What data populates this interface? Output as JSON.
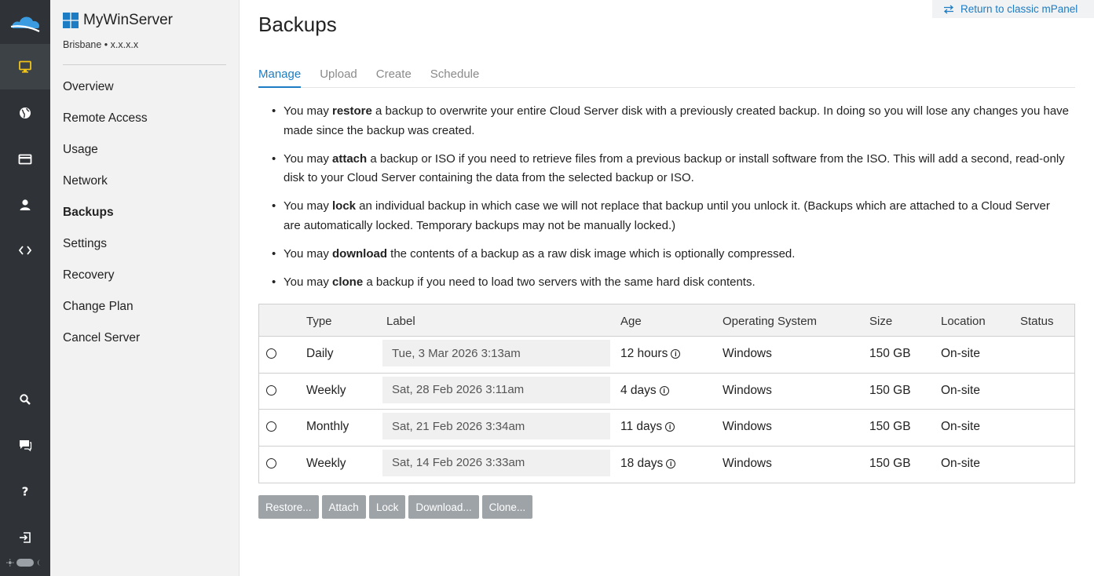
{
  "rail": {
    "items": [
      {
        "icon": "monitor-icon",
        "active": true
      },
      {
        "icon": "globe-icon",
        "active": false
      },
      {
        "icon": "credit-card-icon",
        "active": false
      },
      {
        "icon": "user-icon",
        "active": false
      },
      {
        "icon": "code-icon",
        "active": false
      },
      {
        "icon": "search-icon",
        "active": false
      },
      {
        "icon": "chat-icon",
        "active": false
      },
      {
        "icon": "help-icon",
        "active": false
      },
      {
        "icon": "logout-icon",
        "active": false
      }
    ],
    "accent_color": "#f0c419"
  },
  "server": {
    "name": "MyWinServer",
    "subtitle": "Brisbane • x.x.x.x"
  },
  "nav": {
    "items": [
      {
        "label": "Overview"
      },
      {
        "label": "Remote Access"
      },
      {
        "label": "Usage"
      },
      {
        "label": "Network"
      },
      {
        "label": "Backups",
        "active": true
      },
      {
        "label": "Settings"
      },
      {
        "label": "Recovery"
      },
      {
        "label": "Change Plan"
      },
      {
        "label": "Cancel Server"
      }
    ]
  },
  "header": {
    "title": "Backups",
    "classic_link": "Return to classic mPanel"
  },
  "tabs": [
    {
      "label": "Manage",
      "active": true
    },
    {
      "label": "Upload"
    },
    {
      "label": "Create"
    },
    {
      "label": "Schedule"
    }
  ],
  "info": [
    {
      "pre": "You may ",
      "bold": "restore",
      "post": " a backup to overwrite your entire Cloud Server disk with a previously created backup. In doing so you will lose any changes you have made since the backup was created."
    },
    {
      "pre": "You may ",
      "bold": "attach",
      "post": " a backup or ISO if you need to retrieve files from a previous backup or install software from the ISO. This will add a second, read-only disk to your Cloud Server containing the data from the selected backup or ISO."
    },
    {
      "pre": "You may ",
      "bold": "lock",
      "post": " an individual backup in which case we will not replace that backup until you unlock it. (Backups which are attached to a Cloud Server are automatically locked. Temporary backups may not be manually locked.)"
    },
    {
      "pre": "You may ",
      "bold": "download",
      "post": " the contents of a backup as a raw disk image which is optionally compressed."
    },
    {
      "pre": "You may ",
      "bold": "clone",
      "post": " a backup if you need to load two servers with the same hard disk contents."
    }
  ],
  "table": {
    "headers": {
      "type": "Type",
      "label": "Label",
      "age": "Age",
      "os": "Operating System",
      "size": "Size",
      "location": "Location",
      "status": "Status"
    },
    "rows": [
      {
        "type": "Daily",
        "label": "Tue, 3 Mar 2026 3:13am",
        "age": "12 hours",
        "os": "Windows",
        "size": "150 GB",
        "location": "On-site",
        "status": ""
      },
      {
        "type": "Weekly",
        "label": "Sat, 28 Feb 2026 3:11am",
        "age": "4 days",
        "os": "Windows",
        "size": "150 GB",
        "location": "On-site",
        "status": ""
      },
      {
        "type": "Monthly",
        "label": "Sat, 21 Feb 2026 3:34am",
        "age": "11 days",
        "os": "Windows",
        "size": "150 GB",
        "location": "On-site",
        "status": ""
      },
      {
        "type": "Weekly",
        "label": "Sat, 14 Feb 2026 3:33am",
        "age": "18 days",
        "os": "Windows",
        "size": "150 GB",
        "location": "On-site",
        "status": ""
      }
    ]
  },
  "actions": {
    "restore": "Restore...",
    "attach": "Attach",
    "lock": "Lock",
    "download": "Download...",
    "clone": "Clone..."
  },
  "colors": {
    "accent": "#1c7cc4",
    "rail_bg": "#2f3337",
    "button_disabled": "#9ea3a8"
  }
}
